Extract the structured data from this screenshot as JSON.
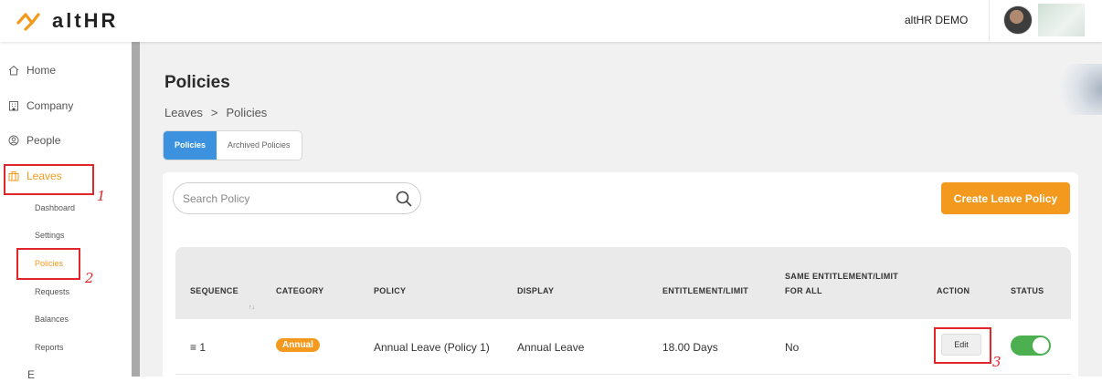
{
  "header": {
    "brand": "altHR",
    "company": "altHR DEMO"
  },
  "sidebar": {
    "items": [
      {
        "label": "Home",
        "icon": "home-icon"
      },
      {
        "label": "Company",
        "icon": "building-icon"
      },
      {
        "label": "People",
        "icon": "user-circle-icon"
      },
      {
        "label": "Leaves",
        "icon": "suitcase-icon"
      }
    ],
    "leaves_sub": [
      "Dashboard",
      "Settings",
      "Policies",
      "Requests",
      "Balances",
      "Reports"
    ],
    "partial_item": "E"
  },
  "annotations": [
    "1",
    "2",
    "3"
  ],
  "page": {
    "title": "Policies",
    "breadcrumb": [
      "Leaves",
      "Policies"
    ],
    "breadcrumb_sep": ">"
  },
  "tabs": [
    "Policies",
    "Archived Policies"
  ],
  "search": {
    "placeholder": "Search Policy"
  },
  "create_button": "Create Leave Policy",
  "table": {
    "headers": [
      "SEQUENCE",
      "CATEGORY",
      "POLICY",
      "DISPLAY",
      "ENTITLEMENT/LIMIT",
      "SAME ENTITLEMENT/LIMIT",
      "FOR ALL",
      "ACTION",
      "STATUS"
    ],
    "sort_glyph": "↑↓",
    "rows": [
      {
        "sequence": "≡ 1",
        "category": "Annual",
        "policy": "Annual Leave (Policy 1)",
        "display": "Annual Leave",
        "entitlement": "18.00 Days",
        "same_for_all": "No",
        "action": "Edit",
        "status_on": true
      }
    ]
  },
  "colors": {
    "accent": "#f39a1e",
    "tab_active": "#3d92e0",
    "toggle_on": "#4caf50",
    "annotation": "#e0262b"
  }
}
